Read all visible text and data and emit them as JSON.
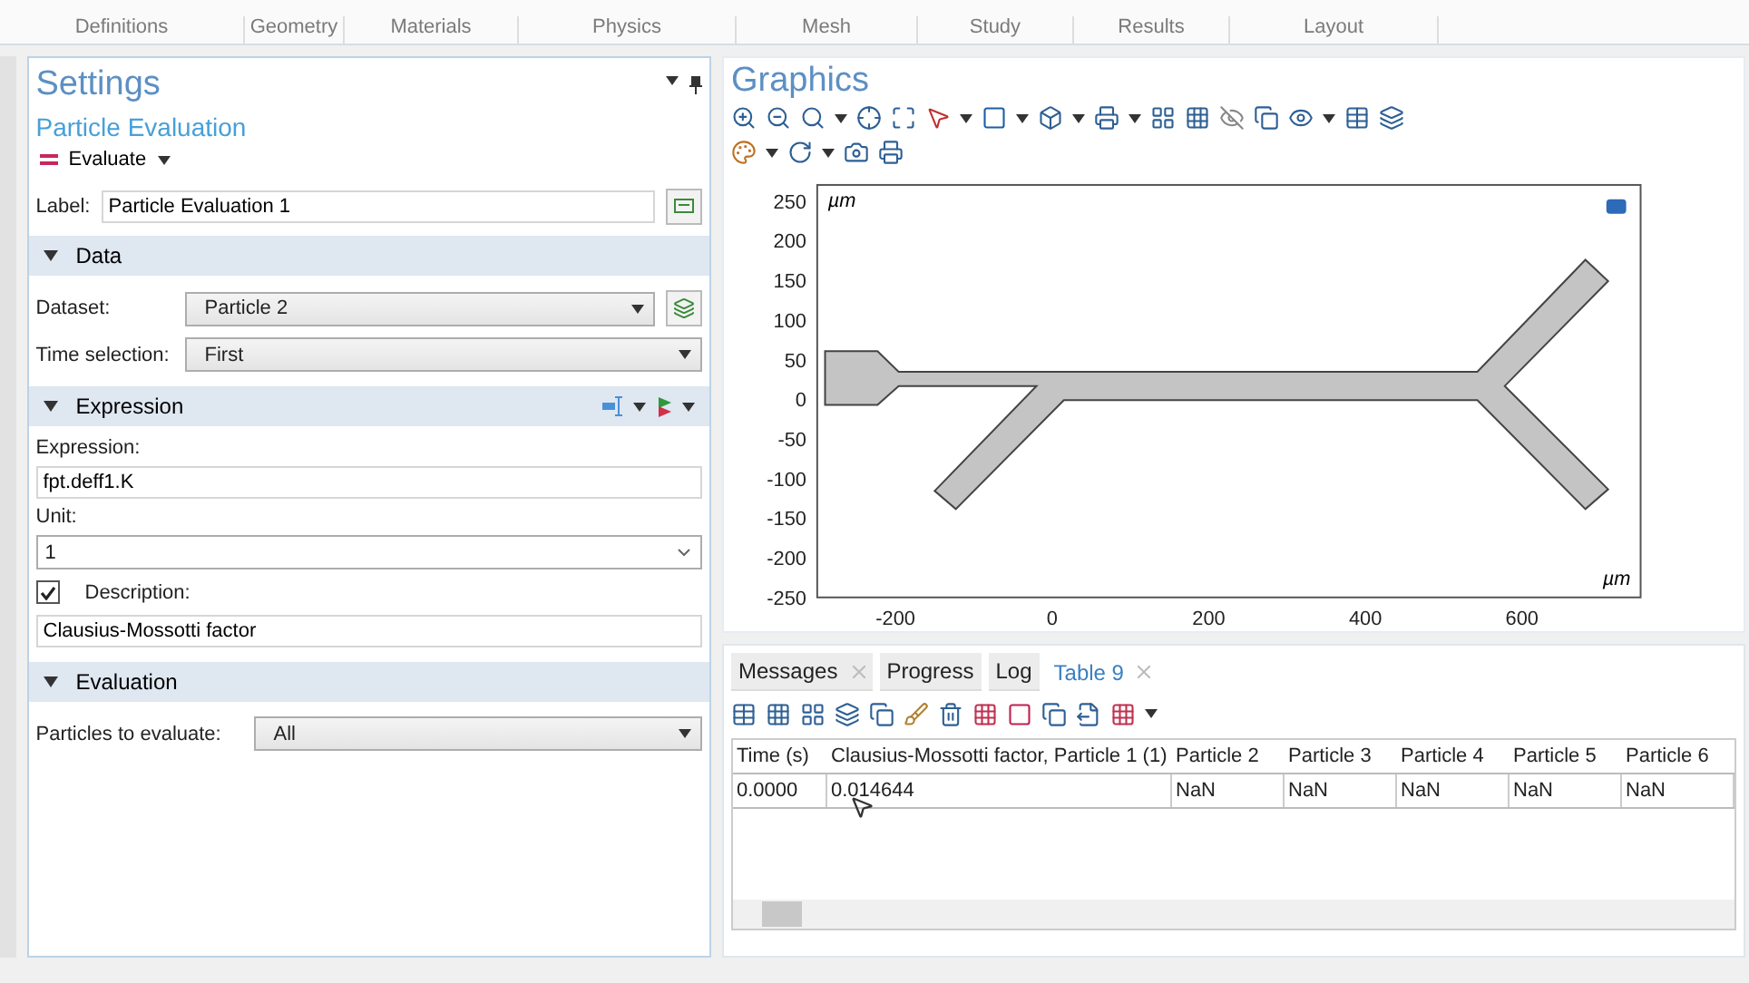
{
  "ribbon_groups": [
    "Definitions",
    "Geometry",
    "Materials",
    "Physics",
    "Mesh",
    "Study",
    "Results",
    "Layout"
  ],
  "settings": {
    "title": "Settings",
    "subtitle": "Particle Evaluation",
    "evaluate_button": "Evaluate",
    "label_field": {
      "label": "Label:",
      "value": "Particle Evaluation 1"
    },
    "sections": [
      {
        "kind": "data",
        "title": "Data",
        "expanded": true,
        "dataset": {
          "label": "Dataset:",
          "value": "Particle 2"
        },
        "time_selection": {
          "label": "Time selection:",
          "value": "First"
        }
      },
      {
        "kind": "expression",
        "title": "Expression",
        "expanded": true,
        "expression": {
          "label": "Expression:",
          "value": "fpt.deff1.K"
        },
        "unit": {
          "label": "Unit:",
          "value": "1"
        },
        "description": {
          "label": "Description:",
          "checked": true,
          "value": "Clausius-Mossotti factor"
        }
      },
      {
        "kind": "evaluation",
        "title": "Evaluation",
        "expanded": true,
        "particles": {
          "label": "Particles to evaluate:",
          "value": "All"
        }
      }
    ]
  },
  "graphics": {
    "title": "Graphics",
    "y_tick_labels": [
      "250",
      "200",
      "150",
      "100",
      "50",
      "0",
      "-50",
      "-100",
      "-150",
      "-200",
      "-250"
    ],
    "x_tick_labels": [
      "-200",
      "0",
      "200",
      "400",
      "600"
    ],
    "unit_labels": [
      "µm",
      "µm"
    ]
  },
  "results": {
    "tabs": [
      {
        "label": "Messages",
        "closable": true,
        "selected": false
      },
      {
        "label": "Progress",
        "closable": false,
        "selected": false
      },
      {
        "label": "Log",
        "closable": false,
        "selected": false
      },
      {
        "label": "Table 9",
        "closable": true,
        "selected": true
      }
    ],
    "table": {
      "columns": [
        "Time (s)",
        "Clausius-Mossotti factor, Particle 1 (1)",
        "Particle 2",
        "Particle 3",
        "Particle 4",
        "Particle 5",
        "Particle 6"
      ],
      "rows": [
        [
          "0.0000",
          "0.014644",
          "NaN",
          "NaN",
          "NaN",
          "NaN",
          "NaN"
        ]
      ]
    }
  }
}
